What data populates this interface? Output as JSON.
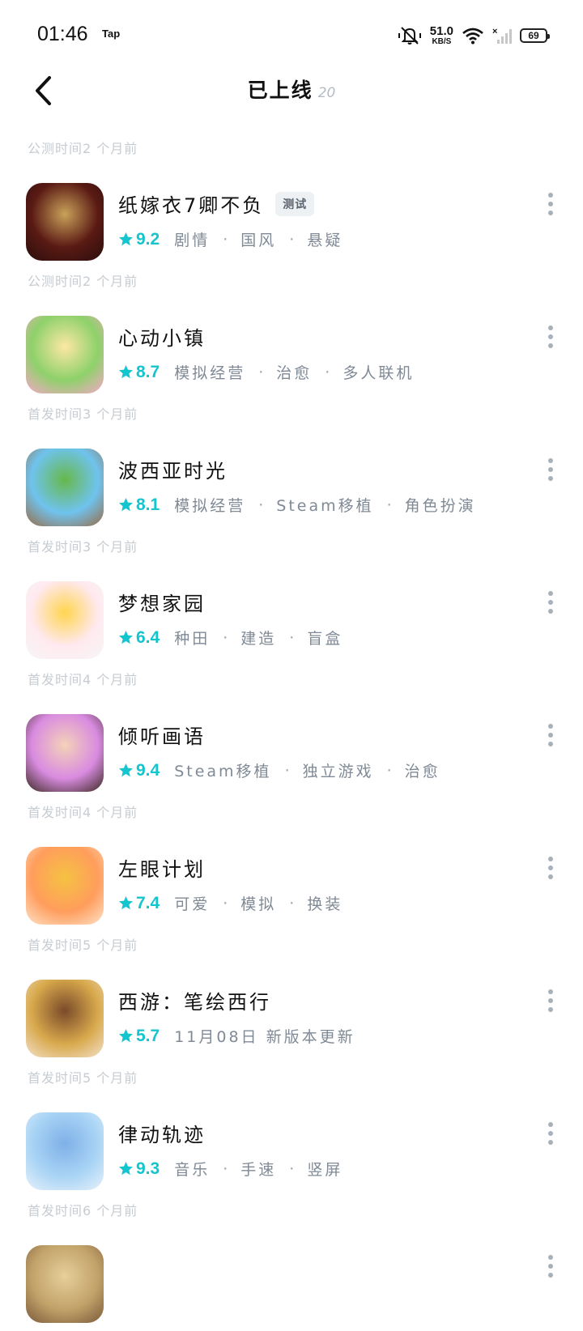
{
  "status_bar": {
    "time": "01:46",
    "app_label": "Tap",
    "net_speed_value": "51.0",
    "net_speed_unit": "KB/S",
    "battery": "69",
    "icons": [
      "mute-bell-icon",
      "wifi-icon",
      "no-signal-icon",
      "battery-icon"
    ]
  },
  "header": {
    "title": "已上线",
    "count": "20",
    "back_icon": "chevron-left-icon"
  },
  "colors": {
    "accent": "#15c5ce",
    "tag_text": "#7f8a96",
    "date_text": "#c6ccd2"
  },
  "games": [
    {
      "date_label": "公测时间2 个月前",
      "name": "纸嫁衣7卿不负",
      "badge": "测试",
      "score": "9.2",
      "tags": [
        "剧情",
        "国风",
        "悬疑"
      ],
      "icon_colors": [
        "#5a1a14",
        "#2a0e0c",
        "#c9a25a"
      ]
    },
    {
      "date_label": "公测时间2 个月前",
      "name": "心动小镇",
      "badge": "",
      "score": "8.7",
      "tags": [
        "模拟经营",
        "治愈",
        "多人联机"
      ],
      "icon_colors": [
        "#8ed16a",
        "#f7a7c9",
        "#fde7a4"
      ]
    },
    {
      "date_label": "首发时间3 个月前",
      "name": "波西亚时光",
      "badge": "",
      "score": "8.1",
      "tags": [
        "模拟经营",
        "Steam移植",
        "角色扮演"
      ],
      "icon_colors": [
        "#6fc3ee",
        "#9a6b45",
        "#67b84a"
      ]
    },
    {
      "date_label": "首发时间3 个月前",
      "name": "梦想家园",
      "badge": "",
      "score": "6.4",
      "tags": [
        "种田",
        "建造",
        "盲盒"
      ],
      "icon_colors": [
        "#ffe9ef",
        "#f6f6f6",
        "#ffd54f"
      ]
    },
    {
      "date_label": "首发时间4 个月前",
      "name": "倾听画语",
      "badge": "",
      "score": "9.4",
      "tags": [
        "Steam移植",
        "独立游戏",
        "治愈"
      ],
      "icon_colors": [
        "#d98be0",
        "#3b2a22",
        "#f4d2b8"
      ]
    },
    {
      "date_label": "首发时间4 个月前",
      "name": "左眼计划",
      "badge": "",
      "score": "7.4",
      "tags": [
        "可爱",
        "模拟",
        "换装"
      ],
      "icon_colors": [
        "#ff9d5c",
        "#ffe2c8",
        "#f5c242"
      ]
    },
    {
      "date_label": "首发时间5 个月前",
      "name": "西游：笔绘西行",
      "badge": "",
      "score": "5.7",
      "tags": [
        "11月08日 新版本更新"
      ],
      "icon_colors": [
        "#d8a94c",
        "#f3e0c9",
        "#7a4a2a"
      ]
    },
    {
      "date_label": "首发时间5 个月前",
      "name": "律动轨迹",
      "badge": "",
      "score": "9.3",
      "tags": [
        "音乐",
        "手速",
        "竖屏"
      ],
      "icon_colors": [
        "#a9d4f5",
        "#e6f1fb",
        "#7fb0e8"
      ]
    },
    {
      "date_label": "首发时间6 个月前",
      "name": "",
      "badge": "",
      "score": "",
      "tags": [],
      "icon_colors": [
        "#c2a269",
        "#7a5a3a",
        "#e6cf9a"
      ]
    }
  ]
}
